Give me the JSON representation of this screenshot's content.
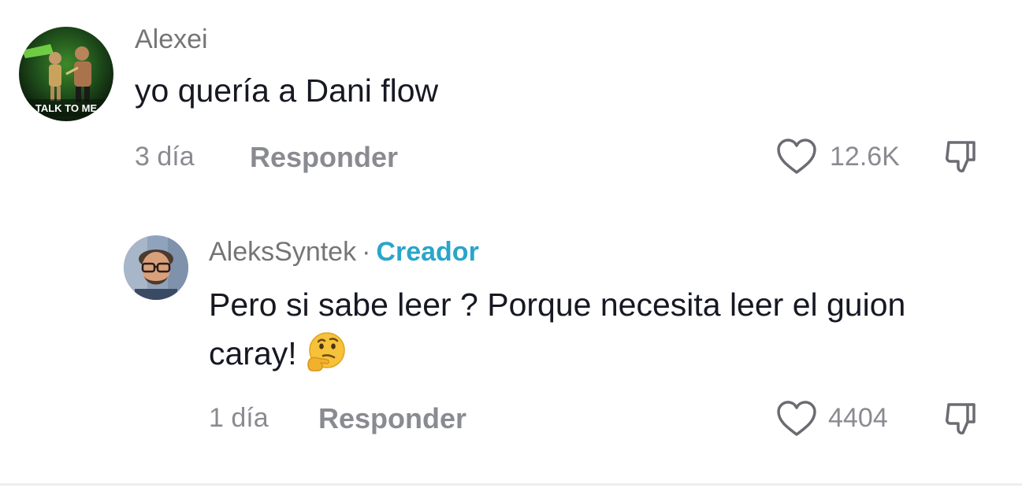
{
  "comments": [
    {
      "username": "Alexei",
      "text": "yo quería a Dani flow",
      "time": "3 día",
      "reply_label": "Responder",
      "likes": "12.6K",
      "avatar": "avatar-wrestlers-talk-to-me",
      "avatar_text": "TALK TO ME"
    },
    {
      "username": "AleksSyntek",
      "separator": "·",
      "badge": "Creador",
      "text": "Pero si sabe leer ? Porque necesita leer el guion caray!",
      "emoji": "thinking-face-emoji",
      "time": "1 día",
      "reply_label": "Responder",
      "likes": "4404",
      "avatar": "avatar-man-glasses"
    }
  ],
  "colors": {
    "text": "#161823",
    "secondary": "#8a8b91",
    "creator_badge": "#2aa5c9",
    "background": "#ffffff"
  },
  "icons": {
    "like": "heart-outline-icon",
    "dislike": "thumbs-down-outline-icon"
  }
}
